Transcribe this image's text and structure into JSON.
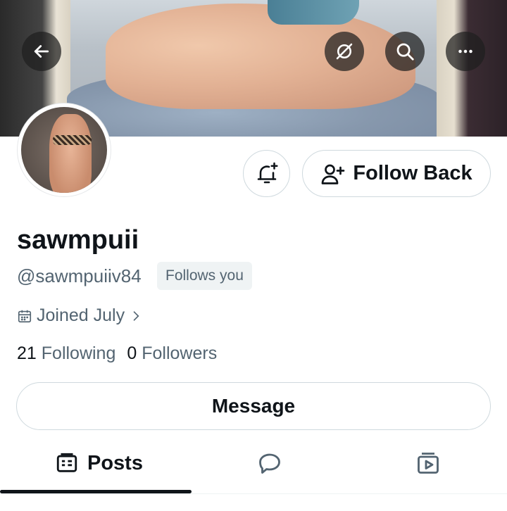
{
  "header": {
    "back_icon": "arrow-left-icon",
    "grok_icon": "grok-icon",
    "search_icon": "search-icon",
    "more_icon": "more-horizontal-icon",
    "button_bg": "#1e1e1e"
  },
  "profile": {
    "display_name": "sawmpuii",
    "handle": "@sawmpuiiv84",
    "follows_you_badge": "Follows you",
    "joined": "Joined July",
    "following_count": "21",
    "following_label": "Following",
    "followers_count": "0",
    "followers_label": "Followers"
  },
  "actions": {
    "notify_icon": "bell-plus-icon",
    "follow_back_label": "Follow Back",
    "follow_icon": "person-plus-icon",
    "message_label": "Message"
  },
  "tabs": [
    {
      "label": "Posts",
      "icon": "posts-icon",
      "selected": true
    },
    {
      "label": "",
      "icon": "reply-bubble-icon",
      "selected": false
    },
    {
      "label": "",
      "icon": "media-play-icon",
      "selected": false
    }
  ],
  "colors": {
    "text_primary": "#0f1419",
    "text_secondary": "#536471",
    "border": "#cfd9de",
    "badge_bg": "#eff3f4"
  }
}
